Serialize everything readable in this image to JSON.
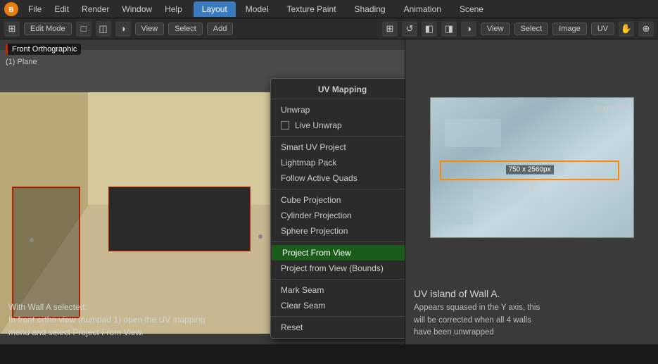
{
  "app": {
    "title": "Blender"
  },
  "top_menu": {
    "items": [
      "Blender",
      "File",
      "Edit",
      "Render",
      "Window",
      "Help"
    ]
  },
  "workspace_tabs": [
    {
      "label": "Layout",
      "active": true
    },
    {
      "label": "Model"
    },
    {
      "label": "Texture Paint"
    },
    {
      "label": "Shading"
    },
    {
      "label": "Animation"
    },
    {
      "label": "Scene"
    }
  ],
  "editor_toolbar": {
    "mode_label": "Edit Mode",
    "view_label": "View",
    "select_label": "Select",
    "add_label": "Add"
  },
  "viewport": {
    "label": "Front Orthographic",
    "sublabel": "(1) Plane"
  },
  "uv_menu": {
    "title": "UV Mapping",
    "items": [
      {
        "label": "Unwrap",
        "type": "item"
      },
      {
        "label": "Live Unwrap",
        "type": "checkbox"
      },
      {
        "separator_after": true
      },
      {
        "label": "Smart UV Project",
        "type": "item"
      },
      {
        "label": "Lightmap Pack",
        "type": "item"
      },
      {
        "label": "Follow Active Quads",
        "type": "item"
      },
      {
        "separator_after": true
      },
      {
        "label": "Cube Projection",
        "type": "item"
      },
      {
        "label": "Cylinder Projection",
        "type": "item"
      },
      {
        "label": "Sphere Projection",
        "type": "item"
      },
      {
        "separator_after": true
      },
      {
        "label": "Project From View",
        "type": "item",
        "highlighted": true
      },
      {
        "label": "Project from View (Bounds)",
        "type": "item"
      },
      {
        "separator_after": true
      },
      {
        "label": "Mark Seam",
        "type": "item"
      },
      {
        "label": "Clear Seam",
        "type": "item"
      },
      {
        "separator_after": true
      },
      {
        "label": "Reset",
        "type": "item"
      }
    ]
  },
  "uv_editor": {
    "toolbar": {
      "view_label": "View",
      "select_label": "Select",
      "image_label": "Image",
      "uv_label": "UV"
    },
    "title": "UV island of Wall A.",
    "description": "Appears squased in the Y axis, this\nwill be corrected when all 4 walls\nhave been unwrapped",
    "size_label": "750 x 2560px",
    "tile_label": "single tile"
  },
  "bottom_text": {
    "line1": "With Wall A selected:",
    "line2": "In front ortho view (numpad 1) open the UV mapping",
    "line3": "menu and select Project From View."
  }
}
